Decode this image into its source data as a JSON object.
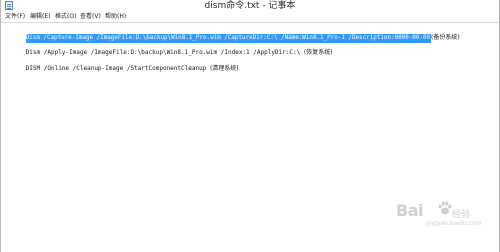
{
  "window": {
    "title": "dism命令.txt - 记事本",
    "icon": "notepad-icon"
  },
  "menubar": {
    "items": [
      "文件(F)",
      "编辑(E)",
      "格式(O)",
      "查看(V)",
      "帮助(H)"
    ]
  },
  "editor": {
    "selection_color": "#3399ff",
    "lines": [
      {
        "cmd": "Dism /Capture-Image /ImageFile:D:\\backup\\Win8.1_Pro.wim /CaptureDir:C:\\ /Name:Win8.1_Pro-1 /Description:0000-00-00",
        "note": "(备份系统)"
      },
      {
        "cmd": "Dism /Apply-Image /ImageFile:D:\\backup\\Win8.1_Pro.wim /Index:1 /ApplyDir:C:\\",
        "note": "(恢复系统)"
      },
      {
        "cmd": "DISM /Online /Cleanup-Image /StartComponentCleanup",
        "note": "(清理系统)"
      }
    ]
  },
  "watermark": {
    "logo": "Bai",
    "logo_icon": "paw-icon",
    "sub": "经验",
    "url": "jingyan.baidu.com"
  }
}
